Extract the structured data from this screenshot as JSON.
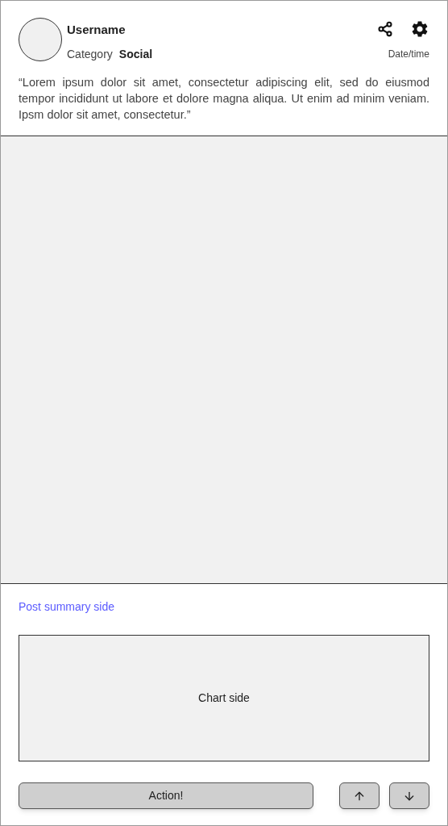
{
  "post": {
    "username": "Username",
    "category_label": "Category",
    "category": "Social",
    "datetime": "Date/time",
    "quote": "“Lorem ipsum dolor sit amet, consectetur adipiscing elit, sed do eiusmod tempor incididunt ut labore et dolore magna aliqua. Ut enim ad minim veniam. Ipsm dolor sit amet, consectetur.”"
  },
  "summary_link": "Post summary side",
  "chart_placeholder": "Chart side",
  "buttons": {
    "action": "Action!"
  }
}
